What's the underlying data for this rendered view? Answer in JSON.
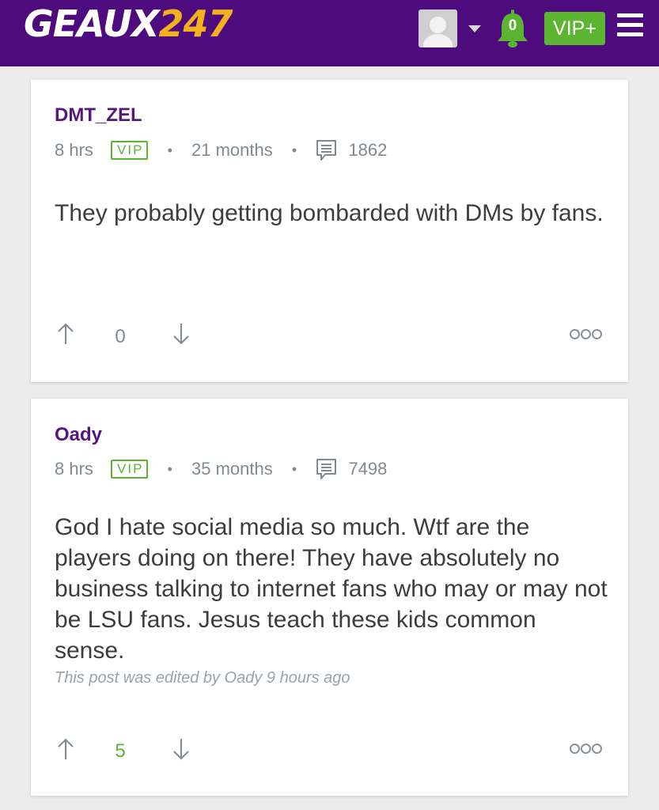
{
  "header": {
    "logo_main": "GEAUX",
    "logo_number": "247",
    "notifications_count": "0",
    "vip_button": "VIP+",
    "brand_color": "#4e0b7d",
    "accent_color": "#5cb531"
  },
  "posts": [
    {
      "author": "DMT_ZEL",
      "time": "8 hrs",
      "badge": "VIP",
      "membership": "21 months",
      "post_count": "1862",
      "body": "They probably getting bombarded with DMs by fans.",
      "edited_note": "",
      "votes": "0"
    },
    {
      "author": "Oady",
      "time": "8 hrs",
      "badge": "VIP",
      "membership": "35 months",
      "post_count": "7498",
      "body": "God I hate social media so much. Wtf are the players doing on there! They have absolutely no business talking to internet fans who may or may not be LSU fans. Jesus teach these kids common sense.",
      "edited_note": "This post was edited by Oady 9 hours ago",
      "votes": "5"
    }
  ],
  "icons": {
    "avatar": "default-user-avatar",
    "dropdown": "caret-down-icon",
    "notifications": "bell-icon",
    "menu": "hamburger-menu-icon",
    "post_count": "message-icon",
    "upvote": "arrow-up-icon",
    "downvote": "arrow-down-icon",
    "more": "more-options-icon"
  }
}
